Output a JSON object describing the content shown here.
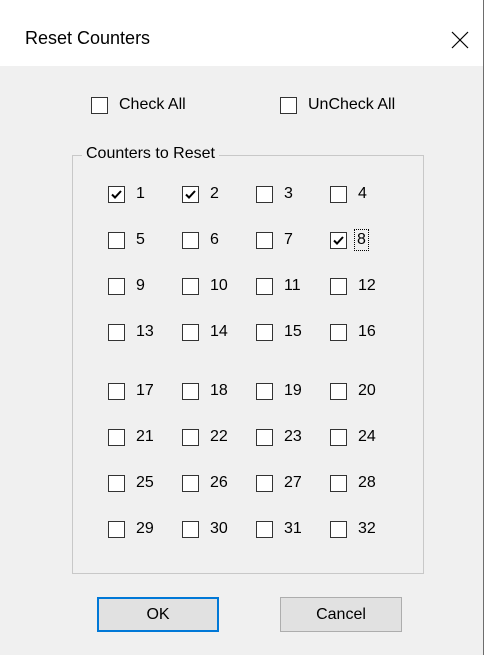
{
  "dialog": {
    "title": "Reset Counters"
  },
  "check_all_label": "Check All",
  "uncheck_all_label": "UnCheck All",
  "group_label": "Counters to Reset",
  "counters": [
    {
      "label": "1",
      "checked": true
    },
    {
      "label": "2",
      "checked": true
    },
    {
      "label": "3",
      "checked": false
    },
    {
      "label": "4",
      "checked": false
    },
    {
      "label": "5",
      "checked": false
    },
    {
      "label": "6",
      "checked": false
    },
    {
      "label": "7",
      "checked": false
    },
    {
      "label": "8",
      "checked": true,
      "focused": true
    },
    {
      "label": "9",
      "checked": false
    },
    {
      "label": "10",
      "checked": false
    },
    {
      "label": "11",
      "checked": false
    },
    {
      "label": "12",
      "checked": false
    },
    {
      "label": "13",
      "checked": false
    },
    {
      "label": "14",
      "checked": false
    },
    {
      "label": "15",
      "checked": false
    },
    {
      "label": "16",
      "checked": false
    },
    {
      "label": "17",
      "checked": false
    },
    {
      "label": "18",
      "checked": false
    },
    {
      "label": "19",
      "checked": false
    },
    {
      "label": "20",
      "checked": false
    },
    {
      "label": "21",
      "checked": false
    },
    {
      "label": "22",
      "checked": false
    },
    {
      "label": "23",
      "checked": false
    },
    {
      "label": "24",
      "checked": false
    },
    {
      "label": "25",
      "checked": false
    },
    {
      "label": "26",
      "checked": false
    },
    {
      "label": "27",
      "checked": false
    },
    {
      "label": "28",
      "checked": false
    },
    {
      "label": "29",
      "checked": false
    },
    {
      "label": "30",
      "checked": false
    },
    {
      "label": "31",
      "checked": false
    },
    {
      "label": "32",
      "checked": false
    }
  ],
  "buttons": {
    "ok_label": "OK",
    "cancel_label": "Cancel"
  },
  "icons": {
    "close": "close-icon",
    "check": "check-mark-icon"
  }
}
